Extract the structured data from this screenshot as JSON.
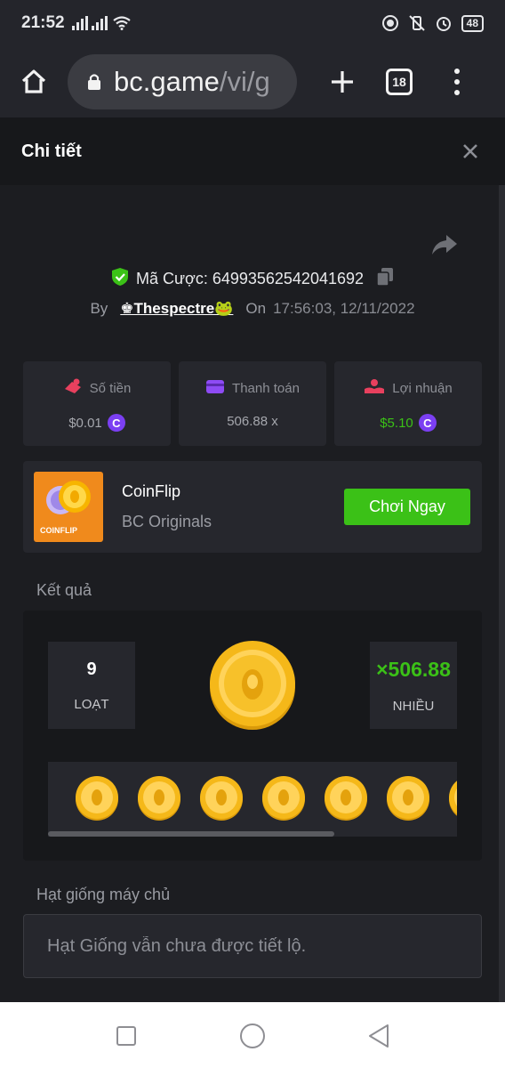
{
  "status_bar": {
    "time": "21:52",
    "battery": "48",
    "icons": [
      "signal-icon",
      "wifi-icon",
      "screen-record-icon",
      "vibrate-off-icon",
      "alarm-icon",
      "battery-icon"
    ]
  },
  "browser": {
    "url_host": "bc.game",
    "url_path": "/vi/g",
    "tab_count": "18"
  },
  "detail": {
    "title": "Chi tiết"
  },
  "bet": {
    "id_label": "Mã Cược:",
    "id_value": "64993562542041692",
    "by_label": "By",
    "username": "♚Thespectre🐸",
    "on_label": "On",
    "datetime": "17:56:03, 12/11/2022"
  },
  "stats": [
    {
      "label": "Số tiền",
      "value": "$0.01",
      "icon": "bet-amount-icon",
      "value_color": "#a5a7ad"
    },
    {
      "label": "Thanh toán",
      "value": "506.88 x",
      "icon": "wallet-icon",
      "value_color": "#a5a7ad"
    },
    {
      "label": "Lợi nhuận",
      "value": "$5.10",
      "icon": "profit-icon",
      "value_color": "#3bc117"
    }
  ],
  "game": {
    "name": "CoinFlip",
    "provider": "BC Originals",
    "thumb_label": "COINFLIP",
    "play_label": "Chơi Ngay"
  },
  "result": {
    "section_label": "Kết quả",
    "series_value": "9",
    "series_label": "LOẠT",
    "multiplier_value": "×506.88",
    "multiplier_label": "NHIỀU"
  },
  "seed": {
    "section_label": "Hạt giống máy chủ",
    "placeholder": "Hạt Giống vẫn chưa được tiết lộ."
  },
  "colors": {
    "accent_green": "#3bc117",
    "brand_purple": "#7b3ff2",
    "shield_green": "#3bc117"
  }
}
